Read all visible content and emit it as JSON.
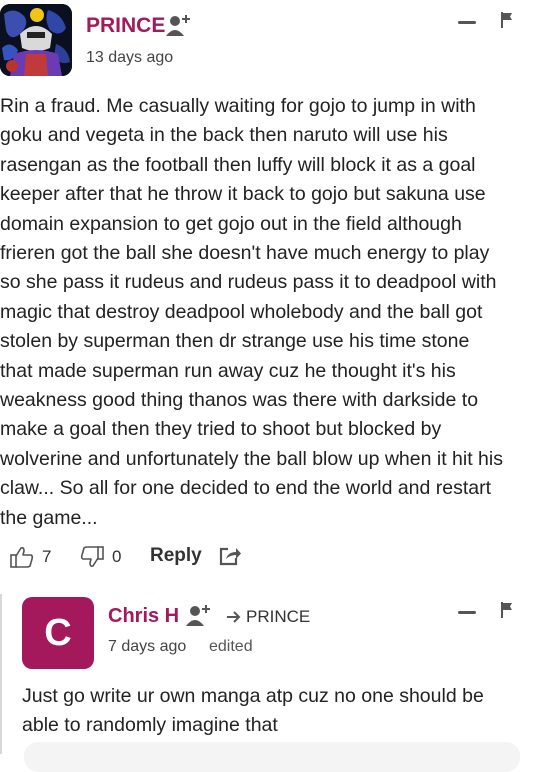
{
  "colors": {
    "author_name": "#a3195b",
    "reply_avatar_bg": "#a3195b",
    "icon_gray": "#555555"
  },
  "comment": {
    "author": "PRINCE",
    "time": "13 days ago",
    "body": "Rin a fraud. Me casually waiting for gojo to jump in with\ngoku and vegeta in the back then naruto will use his\nrasengan as the football then luffy will block it as a goal\nkeeper after that he throw it back to gojo but sakuna use\ndomain expansion to get gojo out in the field although\nfrieren got the ball she doesn't have much energy to play\nso she pass it rudeus and rudeus pass it to deadpool with\nmagic that destroy deadpool wholebody and the ball got\nstolen by superman then dr strange use his time stone\nthat made superman run away cuz he thought it's his\nweakness good thing thanos was there with darkside to\nmake a goal then they tried to shoot but blocked by\nwolverine and unfortunately the ball blow up when it hit his\nclaw... So all for one decided to end the world and restart\nthe game...",
    "likes": "7",
    "dislikes": "0",
    "reply_label": "Reply",
    "icons": {
      "avatar": "anime-avatar-icon",
      "follow": "follow-user-icon",
      "minimize": "minimize-icon",
      "flag": "flag-icon",
      "like": "thumbs-up-icon",
      "dislike": "thumbs-down-icon",
      "share": "share-icon"
    }
  },
  "reply": {
    "avatar_letter": "C",
    "author": "Chris H",
    "reply_to": "PRINCE",
    "time": "7 days ago",
    "edited": "edited",
    "body": "Just go write ur own manga atp cuz no one should be\nable to randomly imagine that",
    "icons": {
      "follow": "follow-user-icon",
      "reply_to": "reply-arrow-icon",
      "minimize": "minimize-icon",
      "flag": "flag-icon"
    }
  }
}
